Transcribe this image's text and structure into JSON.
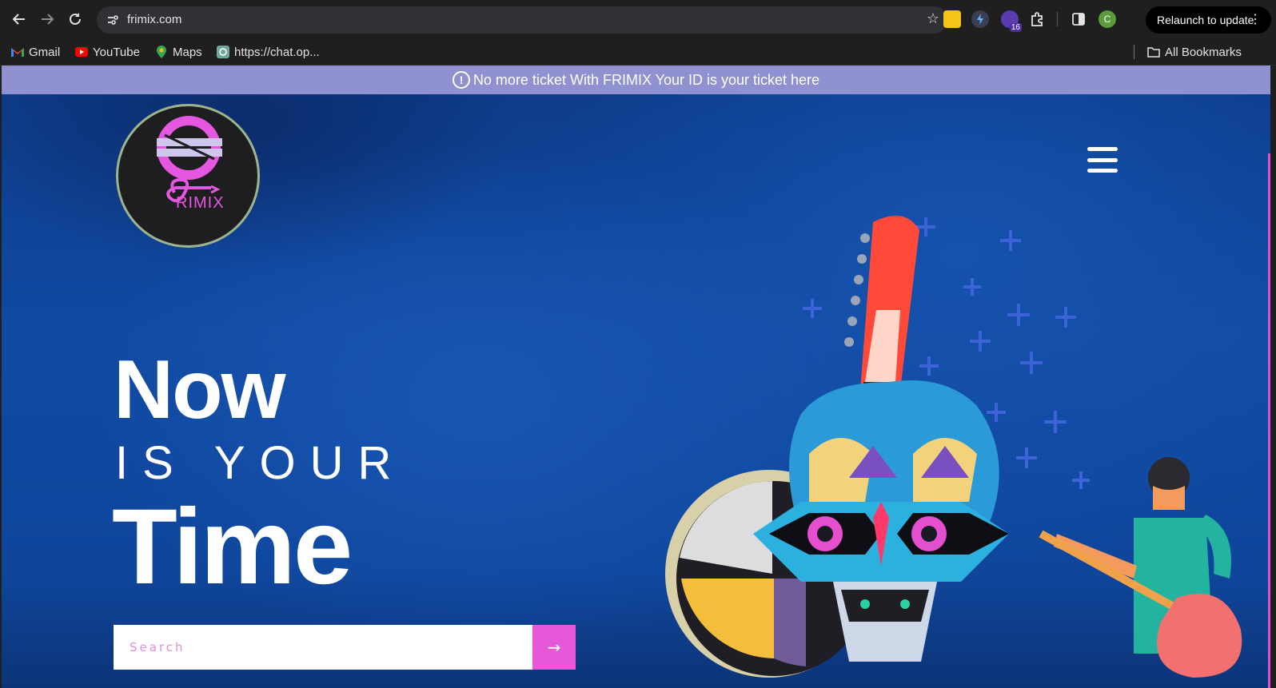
{
  "browser": {
    "url": "frimix.com",
    "relaunch_label": "Relaunch to update",
    "extension_badge": "16",
    "profile_initial": "C",
    "bookmarks": [
      {
        "label": "Gmail"
      },
      {
        "label": "YouTube"
      },
      {
        "label": "Maps"
      },
      {
        "label": "https://chat.op..."
      }
    ],
    "all_bookmarks_label": "All Bookmarks"
  },
  "announcement": {
    "icon": "!",
    "text": "No more ticket With FRIMIX Your ID is your ticket here"
  },
  "logo": {
    "wordmark": "RIMIX",
    "colors": {
      "ring": "#e657e1",
      "bar": "#cfc6ec",
      "bg": "#1e1e20",
      "border": "#9db58f"
    }
  },
  "hero": {
    "line1": "Now",
    "line2": "IS YOUR",
    "line3": "Time",
    "search_placeholder": "Search",
    "search_button_icon": "→"
  },
  "colors": {
    "accent": "#e559d8",
    "banner": "#8f91d1",
    "hero_blue": "#114aa3"
  }
}
